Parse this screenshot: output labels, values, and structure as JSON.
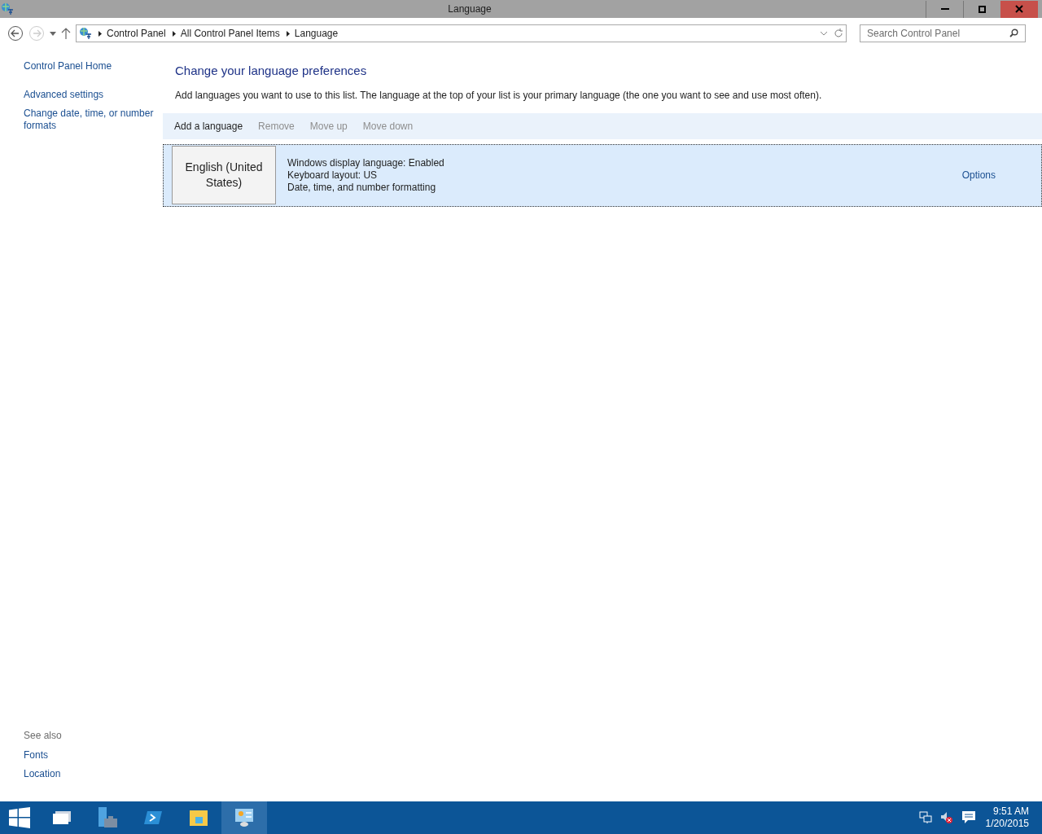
{
  "window": {
    "title": "Language"
  },
  "address": {
    "crumbs": [
      "Control Panel",
      "All Control Panel Items",
      "Language"
    ]
  },
  "search": {
    "placeholder": "Search Control Panel"
  },
  "sidebar": {
    "items": [
      "Control Panel Home",
      "Advanced settings",
      "Change date, time, or number formats"
    ],
    "see_also": {
      "heading": "See also",
      "items": [
        "Fonts",
        "Location"
      ]
    }
  },
  "content": {
    "heading": "Change your language preferences",
    "description": "Add languages you want to use to this list. The language at the top of your list is your primary language (the one you want to see and use most often).",
    "toolbar": [
      {
        "label": "Add a language",
        "disabled": false
      },
      {
        "label": "Remove",
        "disabled": true
      },
      {
        "label": "Move up",
        "disabled": true
      },
      {
        "label": "Move down",
        "disabled": true
      }
    ],
    "languages": [
      {
        "name": "English (United States)",
        "selected": true,
        "details": [
          "Windows display language: Enabled",
          "Keyboard layout: US",
          "Date, time, and number formatting"
        ],
        "options": "Options"
      }
    ]
  },
  "taskbar": {
    "apps": [
      {
        "kind": "tasks",
        "active": false
      },
      {
        "kind": "server",
        "active": false
      },
      {
        "kind": "shell",
        "active": false
      },
      {
        "kind": "folder",
        "active": false
      },
      {
        "kind": "control",
        "active": true
      }
    ],
    "time": "9:51 AM",
    "date": "1/20/2015"
  }
}
